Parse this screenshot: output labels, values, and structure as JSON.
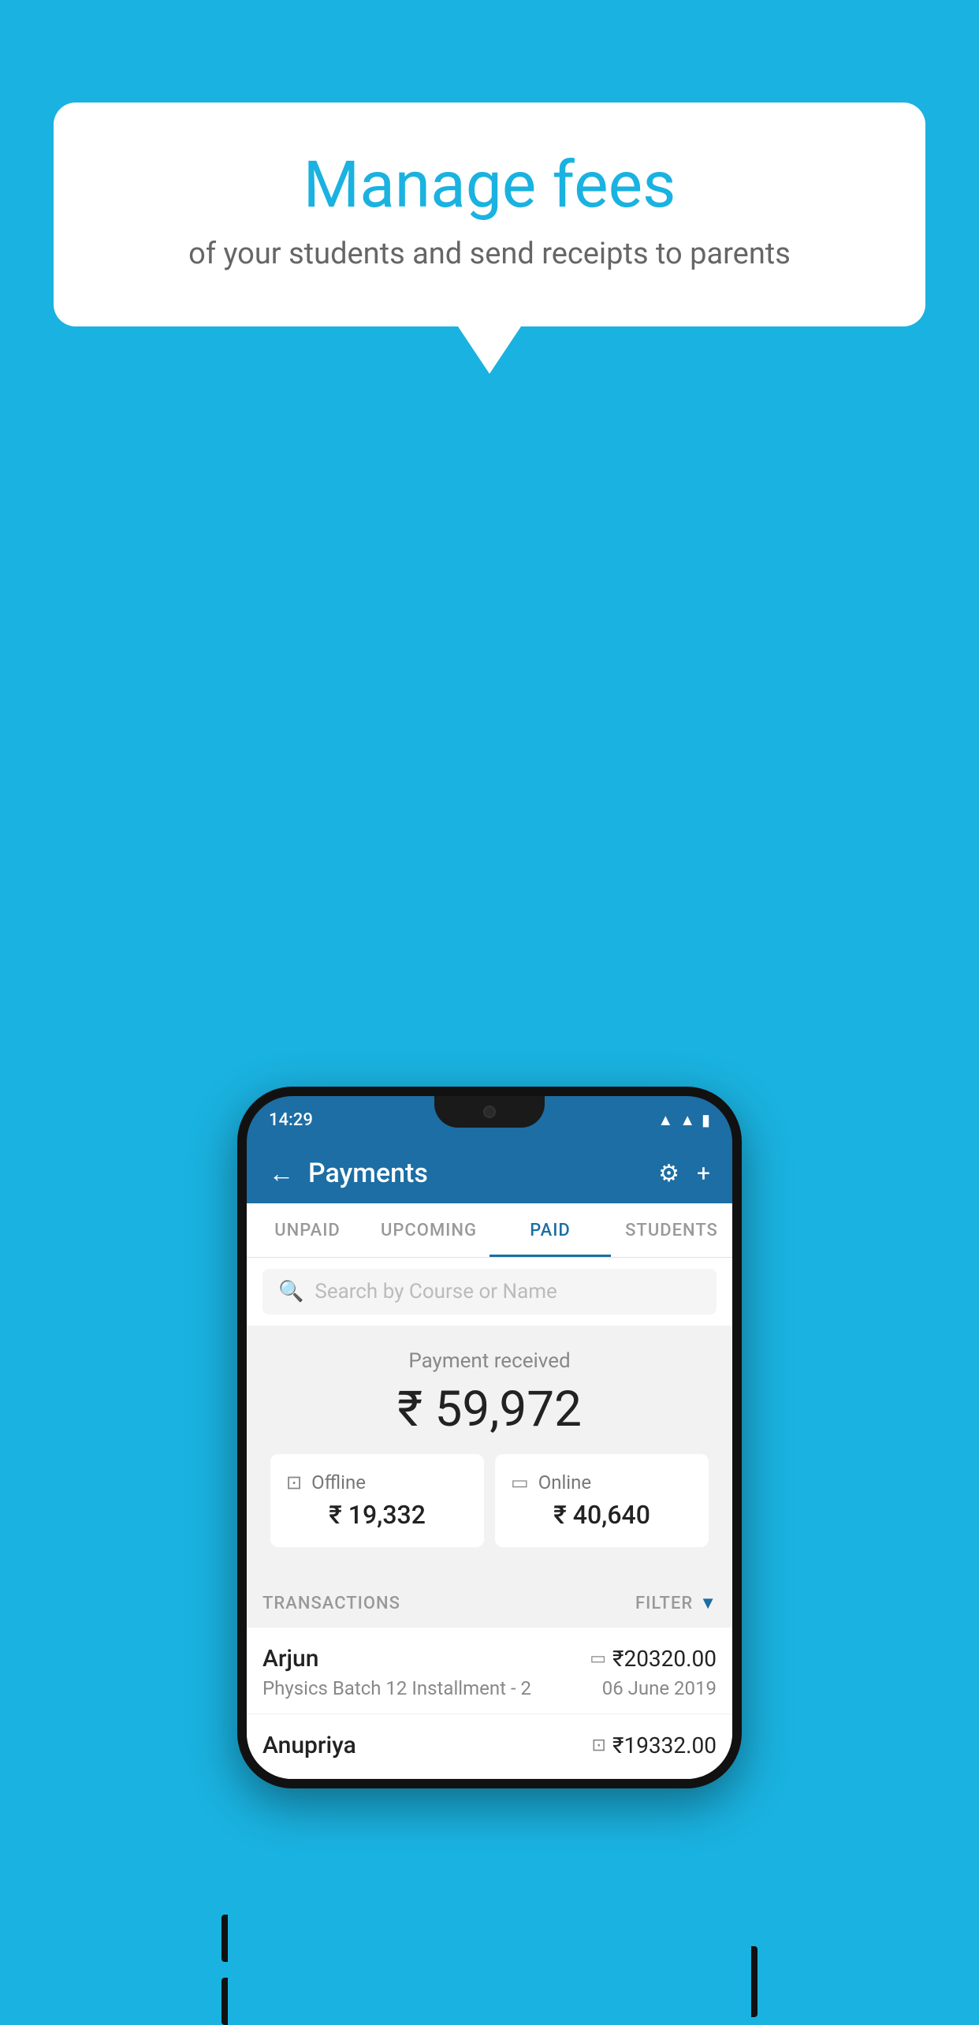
{
  "background_color": "#1ab2e0",
  "speech_bubble": {
    "title": "Manage fees",
    "subtitle": "of your students and send receipts to parents"
  },
  "phone": {
    "status_bar": {
      "time": "14:29"
    },
    "header": {
      "title": "Payments",
      "back_label": "←",
      "settings_label": "⚙",
      "add_label": "+"
    },
    "tabs": [
      {
        "label": "UNPAID",
        "active": false
      },
      {
        "label": "UPCOMING",
        "active": false
      },
      {
        "label": "PAID",
        "active": true
      },
      {
        "label": "STUDENTS",
        "active": false
      }
    ],
    "search": {
      "placeholder": "Search by Course or Name"
    },
    "payment_summary": {
      "label": "Payment received",
      "amount": "₹ 59,972",
      "offline": {
        "type": "Offline",
        "amount": "₹ 19,332"
      },
      "online": {
        "type": "Online",
        "amount": "₹ 40,640"
      }
    },
    "transactions": {
      "section_label": "TRANSACTIONS",
      "filter_label": "FILTER",
      "items": [
        {
          "name": "Arjun",
          "amount": "₹20320.00",
          "course": "Physics Batch 12 Installment - 2",
          "date": "06 June 2019",
          "payment_type": "online"
        },
        {
          "name": "Anupriya",
          "amount": "₹19332.00",
          "course": "",
          "date": "",
          "payment_type": "offline"
        }
      ]
    }
  }
}
